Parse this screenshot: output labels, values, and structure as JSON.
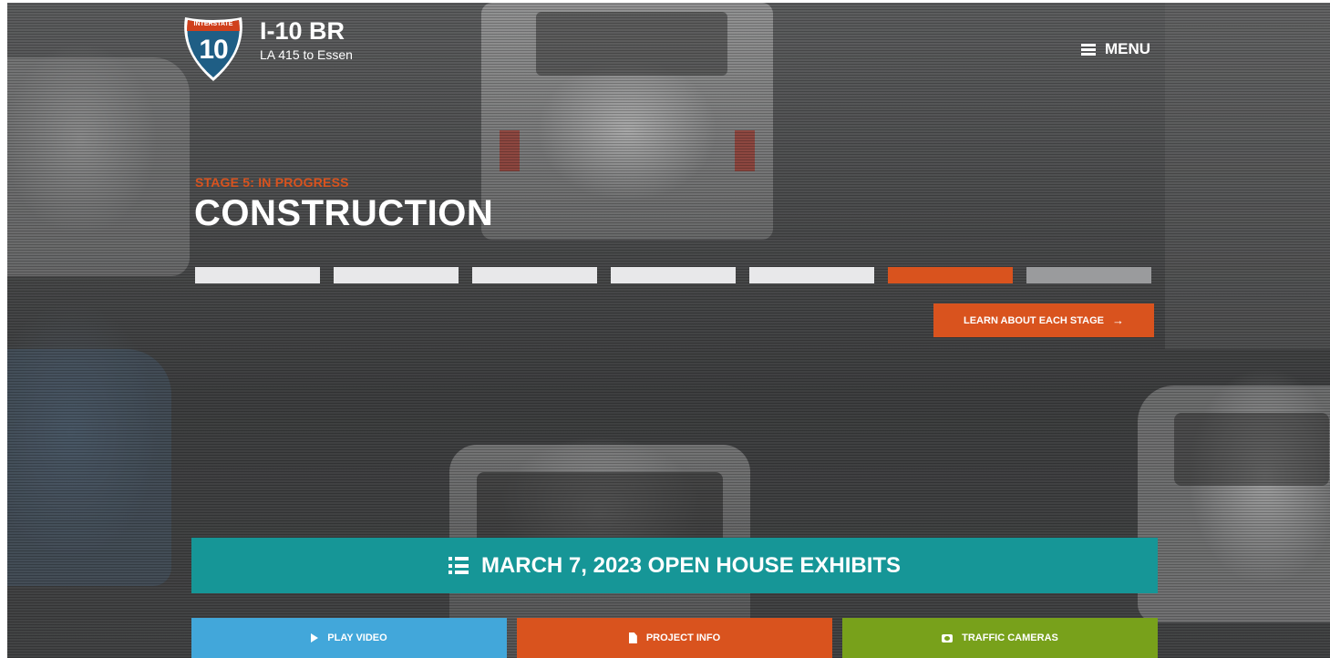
{
  "header": {
    "shield_top_text": "INTERSTATE",
    "shield_number": "10",
    "title": "I-10 BR",
    "subtitle": "LA 415 to Essen",
    "menu_label": "MENU"
  },
  "stage": {
    "label": "STAGE 5: IN PROGRESS",
    "title": "CONSTRUCTION",
    "current_stage_index": 6,
    "total_segments": 7
  },
  "learn_button": {
    "label": "LEARN ABOUT EACH STAGE",
    "arrow": "→"
  },
  "open_house": {
    "label": "MARCH 7, 2023 OPEN HOUSE EXHIBITS",
    "icon": "list-icon"
  },
  "actions": [
    {
      "label": "PLAY VIDEO",
      "icon": "play-icon"
    },
    {
      "label": "PROJECT INFO",
      "icon": "document-icon"
    },
    {
      "label": "TRAFFIC CAMERAS",
      "icon": "camera-icon"
    }
  ],
  "colors": {
    "accent_orange": "#d9531e",
    "teal": "#169697",
    "blue": "#42a7da",
    "green": "#78a11b",
    "shield_blue": "#1f5e85",
    "shield_red": "#d0401c"
  }
}
